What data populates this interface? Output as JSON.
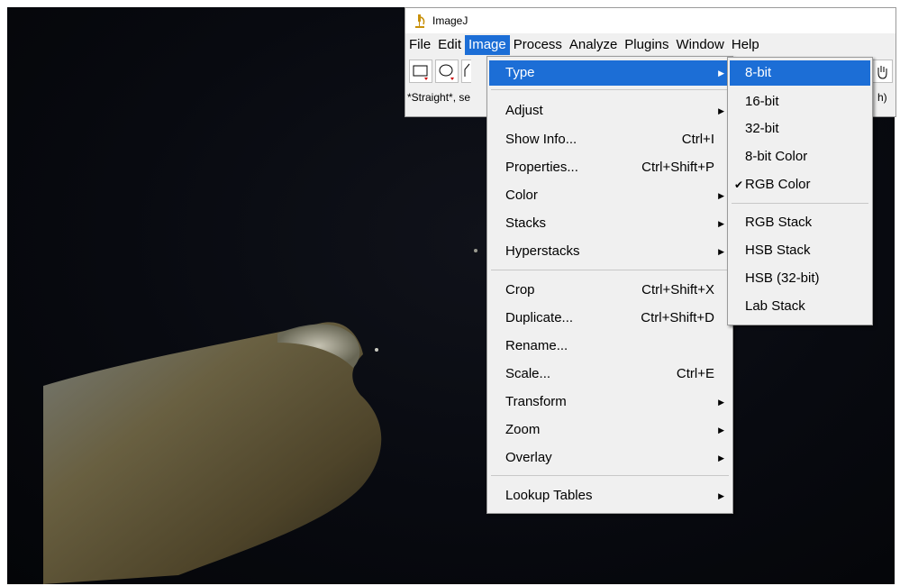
{
  "window": {
    "title": "ImageJ"
  },
  "menubar": [
    "File",
    "Edit",
    "Image",
    "Process",
    "Analyze",
    "Plugins",
    "Window",
    "Help"
  ],
  "menubar_active": "Image",
  "status": {
    "left": "*Straight*, se",
    "right": "h)"
  },
  "image_menu": {
    "type": "Type",
    "adjust": "Adjust",
    "show_info": {
      "label": "Show Info...",
      "shortcut": "Ctrl+I"
    },
    "properties": {
      "label": "Properties...",
      "shortcut": "Ctrl+Shift+P"
    },
    "color": "Color",
    "stacks": "Stacks",
    "hyperstacks": "Hyperstacks",
    "crop": {
      "label": "Crop",
      "shortcut": "Ctrl+Shift+X"
    },
    "duplicate": {
      "label": "Duplicate...",
      "shortcut": "Ctrl+Shift+D"
    },
    "rename": "Rename...",
    "scale": {
      "label": "Scale...",
      "shortcut": "Ctrl+E"
    },
    "transform": "Transform",
    "zoom": "Zoom",
    "overlay": "Overlay",
    "lookup_tables": "Lookup Tables"
  },
  "type_submenu": {
    "bit8": "8-bit",
    "bit16": "16-bit",
    "bit32": "32-bit",
    "bit8_color": "8-bit Color",
    "rgb_color": "RGB Color",
    "rgb_checked": true,
    "rgb_stack": "RGB Stack",
    "hsb_stack": "HSB Stack",
    "hsb_32": "HSB (32-bit)",
    "lab_stack": "Lab Stack"
  },
  "colors": {
    "highlight": "#1c6ed6",
    "menu_bg": "#f0f0f0",
    "image_bg": "#080a10"
  }
}
